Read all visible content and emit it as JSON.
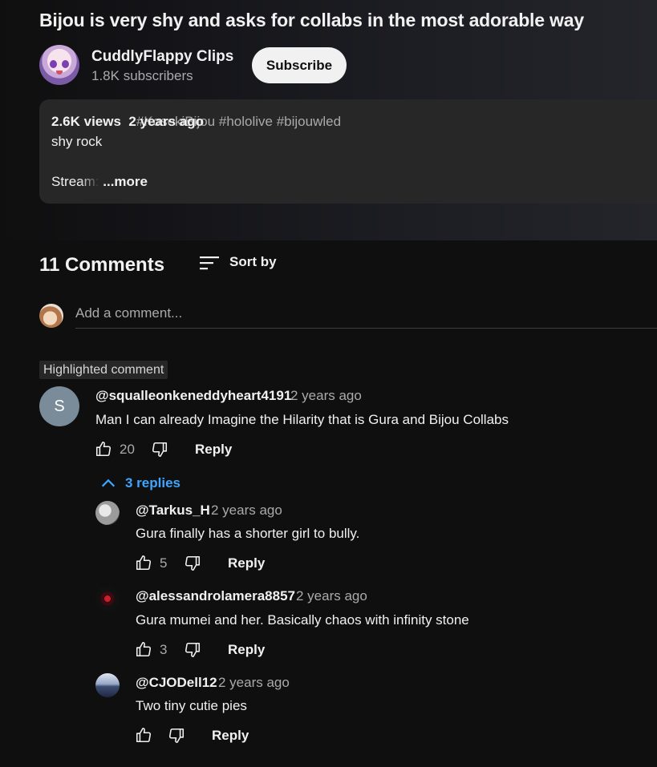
{
  "video": {
    "title": "Bijou is very shy and asks for collabs in the most adorable way",
    "channel_name": "CuddlyFlappy Clips",
    "subscribers": "1.8K subscribers",
    "subscribe_label": "Subscribe"
  },
  "description": {
    "views": "2.6K views",
    "age": "2 years ago",
    "tags": [
      "#KosekiBijou",
      "#hololive",
      "#bijouwled"
    ],
    "line1": "shy rock",
    "stream_prefix": "Stream:",
    "more_label": "...more"
  },
  "comments_header": {
    "count_label": "11 Comments",
    "sort_label": "Sort by"
  },
  "add_comment": {
    "placeholder": "Add a comment..."
  },
  "highlighted_label": "Highlighted comment",
  "comment": {
    "avatar_letter": "S",
    "handle": "@squalleonkeneddyheart4191",
    "age": "2 years ago",
    "text": "Man I can already Imagine the Hilarity that is Gura and Bijou Collabs",
    "likes": "20",
    "reply_label": "Reply",
    "replies_label": "3 replies"
  },
  "replies": [
    {
      "handle": "@Tarkus_H",
      "age": "2 years ago",
      "text": "Gura finally has a shorter girl to bully.",
      "likes": "5",
      "reply_label": "Reply"
    },
    {
      "handle": "@alessandrolamera8857",
      "age": "2 years ago",
      "text": "Gura mumei and her. Basically chaos with infinity stone",
      "likes": "3",
      "reply_label": "Reply"
    },
    {
      "handle": "@CJODell12",
      "age": "2 years ago",
      "text": "Two tiny cutie pies",
      "likes": "",
      "reply_label": "Reply"
    }
  ],
  "icons": {
    "like": "thumb-up-icon",
    "dislike": "thumb-down-icon",
    "sort": "sort-icon",
    "collapse": "chevron-up-icon"
  },
  "colors": {
    "link_blue": "#3ea6ff",
    "background": "#0f0f0f"
  }
}
